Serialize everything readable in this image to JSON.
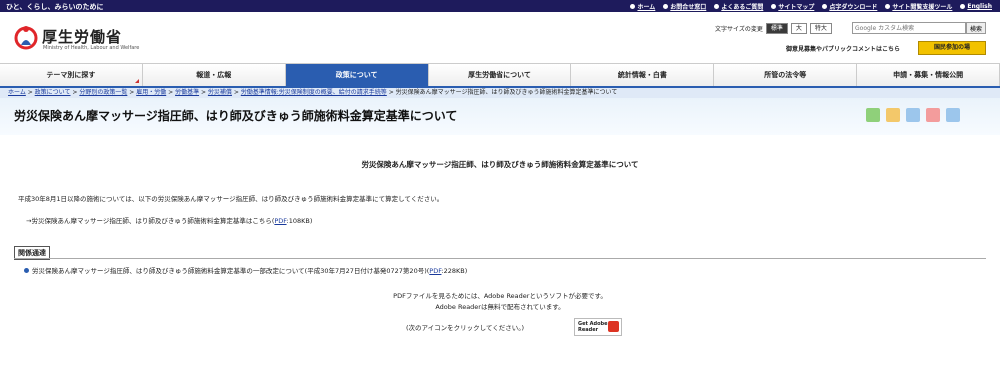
{
  "topbar": {
    "tagline": "ひと、くらし、みらいのために",
    "links": [
      "ホーム",
      "お問合せ窓口",
      "よくあるご質問",
      "サイトマップ",
      "点字ダウンロード",
      "サイト閲覧支援ツール",
      "English"
    ]
  },
  "logo": {
    "name": "厚生労働省",
    "en": "Ministry of Health, Labour and Welfare"
  },
  "fontsize": {
    "label": "文字サイズの変更",
    "options": [
      "標準",
      "大",
      "特大"
    ]
  },
  "search": {
    "placeholder": "Google カスタム検索",
    "button": "検索"
  },
  "pubcom": "御意見募集やパブリックコメントはこちら",
  "kokumin": "国民参加の場",
  "nav": [
    "テーマ別に探す",
    "報道・広報",
    "政策について",
    "厚生労働省について",
    "統計情報・白書",
    "所管の法令等",
    "申請・募集・情報公開"
  ],
  "breadcrumb": [
    "ホーム",
    "政策について",
    "分野別の政策一覧",
    "雇用・労働",
    "労働基準",
    "労災補償",
    "労働基準情報:労災保険制度の概要、給付の請求手続等",
    "労災保険あん摩マッサージ指圧師、はり師及びきゅう師施術料金算定基準について"
  ],
  "page_title": "労災保険あん摩マッサージ指圧師、はり師及びきゅう師施術料金算定基準について",
  "doc_title": "労災保険あん摩マッサージ指圧師、はり師及びきゅう師施術料金算定基準について",
  "p1": "平成30年8月1日以降の施術については、以下の労災保険あん摩マッサージ指圧師、はり師及びきゅう師施術料金算定基準にて算定してください。",
  "p2": {
    "prefix": "→労災保険あん摩マッサージ指圧師、はり師及びきゅう師施術料金算定基準はこちら(",
    "link": "PDF",
    "suffix": ":108KB)"
  },
  "related": {
    "label": "関係通達",
    "item_prefix": "労災保険あん摩マッサージ指圧師、はり師及びきゅう師施術料金算定基準の一部改定について(平成30年7月27日付け基発0727第20号)(",
    "link": "PDF",
    "suffix": ":228KB)"
  },
  "pdfnote": {
    "line1": "PDFファイルを見るためには、Adobe Readerというソフトが必要です。",
    "line2": "Adobe Readerは無料で配布されています。",
    "click": "(次のアイコンをクリックしてください。)"
  },
  "reader_badge": {
    "line1": "Get Adobe",
    "line2": "Reader"
  },
  "colors": {
    "topbar": "#1e1b5c",
    "nav_active": "#2a5db0",
    "kokumin": "#f2c200"
  }
}
